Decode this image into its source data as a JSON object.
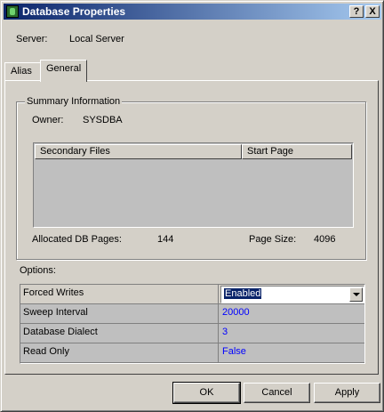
{
  "window": {
    "title": "Database Properties",
    "help_glyph": "?",
    "close_glyph": "X"
  },
  "server": {
    "label": "Server:",
    "value": "Local Server"
  },
  "tabs": [
    {
      "label": "Alias"
    },
    {
      "label": "General",
      "selected": true
    }
  ],
  "summary": {
    "legend": "Summary Information",
    "owner_label": "Owner:",
    "owner_value": "SYSDBA",
    "columns": [
      "Secondary Files",
      "Start Page"
    ],
    "rows": [],
    "allocated_label": "Allocated DB Pages:",
    "allocated_value": "144",
    "page_size_label": "Page Size:",
    "page_size_value": "4096"
  },
  "options": {
    "label": "Options:",
    "rows": [
      {
        "name": "Forced Writes",
        "value": "Enabled"
      },
      {
        "name": "Sweep Interval",
        "value": "20000"
      },
      {
        "name": "Database Dialect",
        "value": "3"
      },
      {
        "name": "Read Only",
        "value": "False"
      }
    ],
    "value_color": "#0000ff",
    "selection_color": "#0a246a"
  },
  "buttons": {
    "ok": "OK",
    "cancel": "Cancel",
    "apply": "Apply"
  }
}
